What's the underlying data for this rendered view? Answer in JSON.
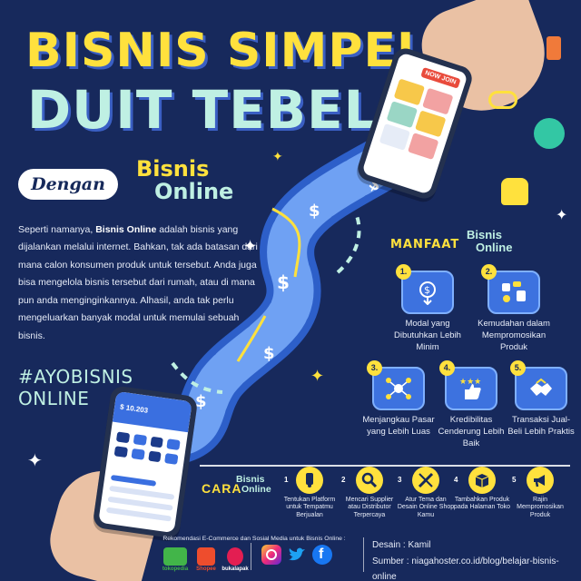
{
  "title": {
    "line1": "BISNIS SIMPEL",
    "line2": "DUIT TEBEL",
    "dengan": "Dengan",
    "bisnis": "Bisnis",
    "online": "Online"
  },
  "intro": {
    "text_before": "Seperti namanya, ",
    "highlight": "Bisnis Online",
    "text_after": " adalah bisnis yang dijalankan melalui internet. Bahkan, tak ada batasan dari mana calon konsumen produk untuk tersebut. Anda juga bisa mengelola bisnis tersebut dari rumah, atau di mana pun anda menginginkannya. Alhasil, anda tak perlu mengeluarkan banyak modal untuk memulai sebuah bisnis."
  },
  "hashtag": {
    "line1": "#AYOBISNIS",
    "line2": "ONLINE"
  },
  "phones": {
    "shop_badge": "NOW JOIN",
    "wallet_amount": "$ 10.203"
  },
  "manfaat": {
    "title": "MANFAAT",
    "sub1": "Bisnis",
    "sub2": "Online",
    "items": [
      {
        "num": "1.",
        "label": "Modal yang Dibutuhkan Lebih Minim",
        "icon": "money-down-icon"
      },
      {
        "num": "2.",
        "label": "Kemudahan dalam Mempromosikan Produk",
        "icon": "social-media-icon"
      },
      {
        "num": "3.",
        "label": "Menjangkau Pasar yang Lebih Luas",
        "icon": "network-icon"
      },
      {
        "num": "4.",
        "label": "Kredibilitas Cenderung Lebih Baik",
        "icon": "thumbs-up-stars-icon"
      },
      {
        "num": "5.",
        "label": "Transaksi Jual-Beli Lebih Praktis",
        "icon": "handshake-icon"
      }
    ]
  },
  "cara": {
    "title": "CARA",
    "sub1": "Bisnis",
    "sub2": "Online",
    "steps": [
      {
        "num": "1",
        "label": "Tentukan Platform untuk Tempatmu Berjualan",
        "icon": "tap-icon"
      },
      {
        "num": "2",
        "label": "Mencari Supplier atau Distributor Terpercaya",
        "icon": "search-icon"
      },
      {
        "num": "3",
        "label": "Atur Tema dan Desain Online Shop Kamu",
        "icon": "design-tools-icon"
      },
      {
        "num": "4",
        "label": "Tambahkan Produk pada Halaman Toko",
        "icon": "box-icon"
      },
      {
        "num": "5",
        "label": "Rajin Mempromosikan Produk",
        "icon": "megaphone-icon"
      }
    ]
  },
  "footer": {
    "recommendation": "Rekomendasi E-Commerce dan Sosial Media untuk Bisnis Online :",
    "marketplaces": [
      "tokopedia",
      "Shopee",
      "bukalapak"
    ],
    "socials": [
      "instagram-icon",
      "twitter-icon",
      "facebook-icon"
    ],
    "design_credit": "Desain : Kamil",
    "source": "Sumber : niagahoster.co.id/blog/belajar-bisnis-online"
  },
  "colors": {
    "background": "#17295c",
    "yellow": "#ffe13d",
    "mint": "#bff0e3",
    "blue": "#3d72df"
  }
}
